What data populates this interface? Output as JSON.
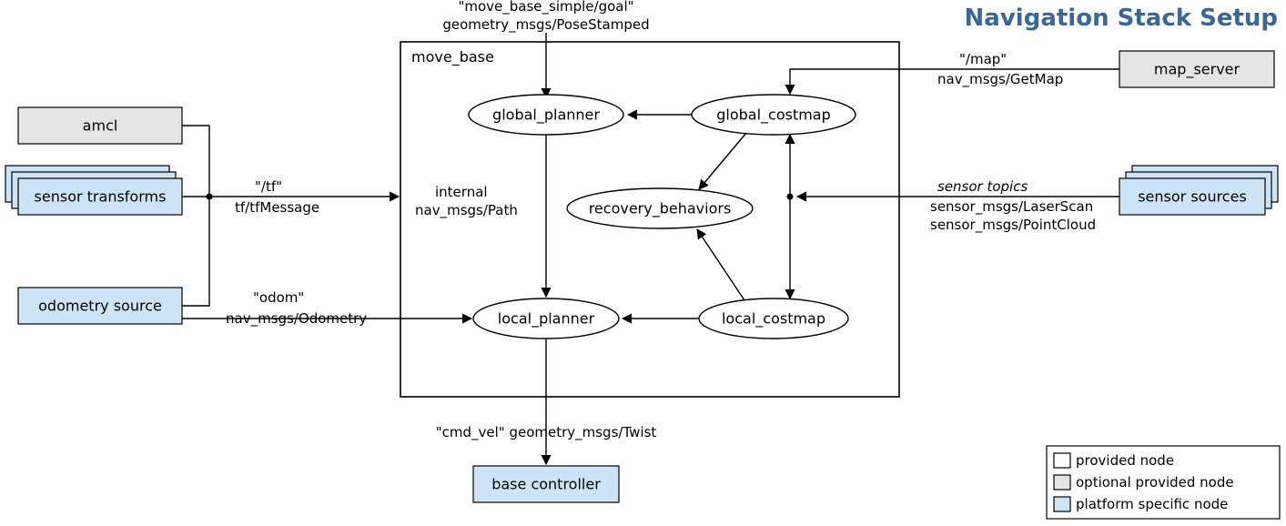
{
  "title": "Navigation Stack Setup",
  "nodes": {
    "amcl": "amcl",
    "sensor_transforms": "sensor transforms",
    "odometry_source": "odometry source",
    "move_base": "move_base",
    "global_planner": "global_planner",
    "global_costmap": "global_costmap",
    "recovery_behaviors": "recovery_behaviors",
    "local_planner": "local_planner",
    "local_costmap": "local_costmap",
    "base_controller": "base controller",
    "map_server": "map_server",
    "sensor_sources": "sensor sources"
  },
  "edges": {
    "goal_topic": "\"move_base_simple/goal\"",
    "goal_type": "geometry_msgs/PoseStamped",
    "tf_topic": "\"/tf\"",
    "tf_type": "tf/tfMessage",
    "internal_label": "internal",
    "internal_type": "nav_msgs/Path",
    "odom_topic": "\"odom\"",
    "odom_type": "nav_msgs/Odometry",
    "cmd_vel": "\"cmd_vel\"  geometry_msgs/Twist",
    "map_topic": "\"/map\"",
    "map_type": "nav_msgs/GetMap",
    "sensor_topics": "sensor topics",
    "sensor_type1": "sensor_msgs/LaserScan",
    "sensor_type2": "sensor_msgs/PointCloud"
  },
  "legend": {
    "provided": "provided node",
    "optional": "optional provided node",
    "platform": "platform specific node"
  }
}
